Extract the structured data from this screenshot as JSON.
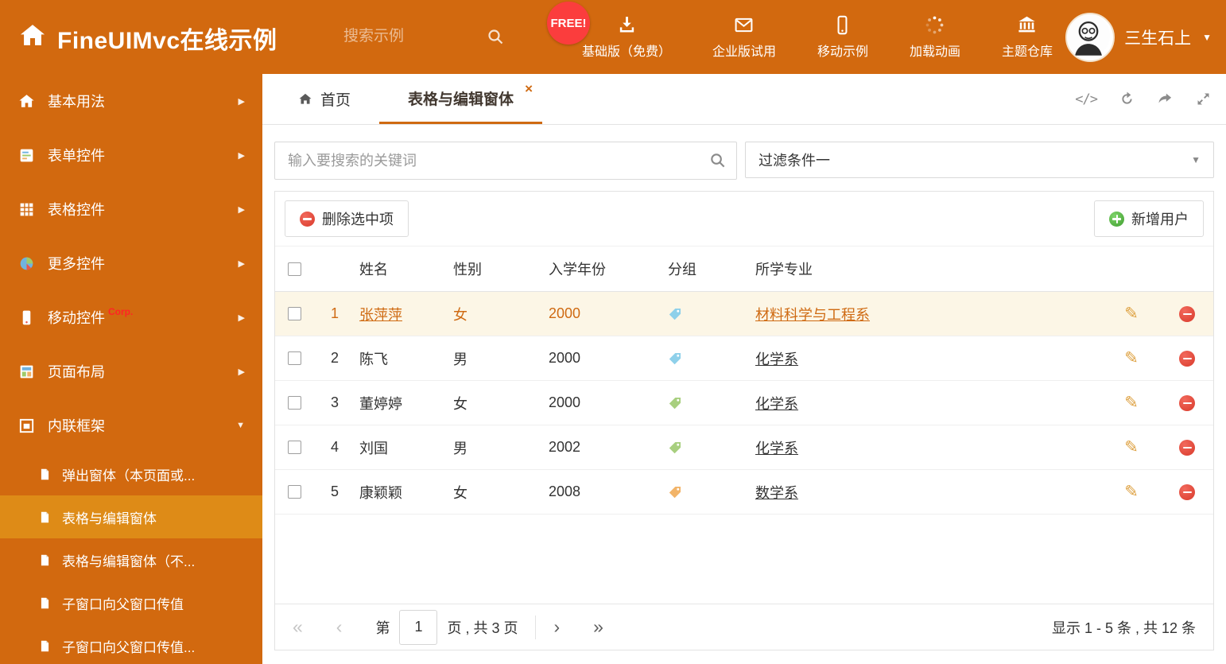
{
  "colors": {
    "orange": "#d2690f",
    "menu_selected": "#de8b17",
    "link": "#cf6a12",
    "row_selected_bg": "#fcf6e6",
    "free_badge": "#fb3d3d",
    "tag_blue": "#8ed0ea",
    "tag_green": "#a8cf7f",
    "tag_orange": "#f2b469"
  },
  "header": {
    "title": "FineUIMvc在线示例",
    "search_placeholder": "搜索示例",
    "free_badge": "FREE!",
    "nav_items": [
      {
        "icon": "download-icon",
        "label": "基础版（免费）"
      },
      {
        "icon": "envelope-icon",
        "label": "企业版试用"
      },
      {
        "icon": "mobile-icon",
        "label": "移动示例"
      },
      {
        "icon": "spinner-icon",
        "label": "加载动画"
      },
      {
        "icon": "bank-icon",
        "label": "主题仓库"
      }
    ],
    "user_name": "三生石上"
  },
  "sidebar": {
    "items": [
      {
        "icon": "home-icon",
        "label": "基本用法",
        "arrow": "right"
      },
      {
        "icon": "form-icon",
        "label": "表单控件",
        "arrow": "right"
      },
      {
        "icon": "table-icon",
        "label": "表格控件",
        "arrow": "right"
      },
      {
        "icon": "controls-icon",
        "label": "更多控件",
        "arrow": "right"
      },
      {
        "icon": "phone-icon",
        "label": "移动控件",
        "badge": "Corp.",
        "arrow": "right"
      },
      {
        "icon": "layout-icon",
        "label": "页面布局",
        "arrow": "right"
      },
      {
        "icon": "frame-icon",
        "label": "内联框架",
        "arrow": "down",
        "expanded": true
      }
    ],
    "subitems": [
      {
        "label": "弹出窗体（本页面或..."
      },
      {
        "label": "表格与编辑窗体",
        "selected": true
      },
      {
        "label": "表格与编辑窗体（不..."
      },
      {
        "label": "子窗口向父窗口传值"
      },
      {
        "label": "子窗口向父窗口传值..."
      }
    ]
  },
  "tabstrip": {
    "tabs": [
      {
        "label": "首页"
      },
      {
        "label": "表格与编辑窗体",
        "active": true,
        "close": "×"
      }
    ]
  },
  "filter": {
    "search_placeholder": "输入要搜索的关键词",
    "filter_value": "过滤条件一"
  },
  "toolbar": {
    "delete_label": "删除选中项",
    "add_label": "新增用户"
  },
  "table": {
    "columns": [
      "姓名",
      "性别",
      "入学年份",
      "分组",
      "所学专业"
    ],
    "rows": [
      {
        "num": "1",
        "name": "张萍萍",
        "gender": "女",
        "year": "2000",
        "tag": "blue",
        "major": "材料科学与工程系",
        "selected": true
      },
      {
        "num": "2",
        "name": "陈飞",
        "gender": "男",
        "year": "2000",
        "tag": "blue",
        "major": "化学系"
      },
      {
        "num": "3",
        "name": "董婷婷",
        "gender": "女",
        "year": "2000",
        "tag": "green",
        "major": "化学系"
      },
      {
        "num": "4",
        "name": "刘国",
        "gender": "男",
        "year": "2002",
        "tag": "green",
        "major": "化学系"
      },
      {
        "num": "5",
        "name": "康颖颖",
        "gender": "女",
        "year": "2008",
        "tag": "orange",
        "major": "数学系"
      }
    ]
  },
  "pagination": {
    "label_page": "第",
    "page_value": "1",
    "label_total": "页 , 共 3 页",
    "summary": "显示 1 - 5 条 , 共 12 条"
  }
}
